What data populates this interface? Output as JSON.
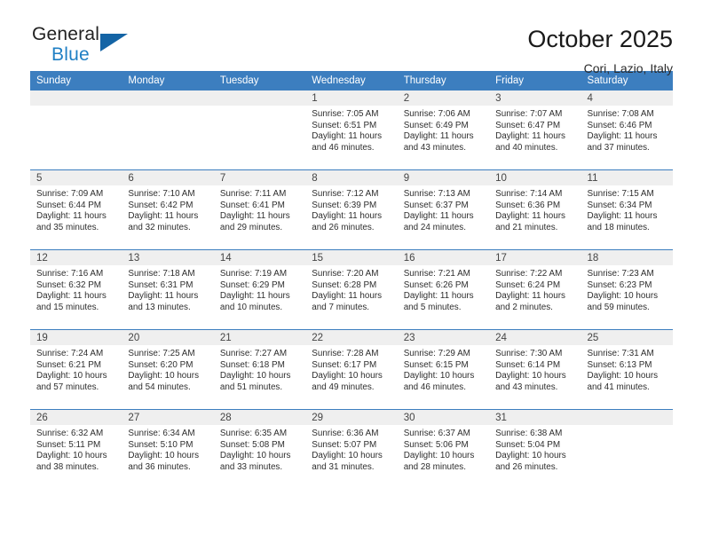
{
  "brand": {
    "name_top": "General",
    "name_bottom": "Blue",
    "accent_color": "#1f7fc4",
    "triangle_color": "#1464a5"
  },
  "header": {
    "title": "October 2025",
    "location": "Cori, Lazio, Italy"
  },
  "calendar": {
    "header_bg": "#3c7ebf",
    "daynum_bg": "#efefef",
    "weekday_names": [
      "Sunday",
      "Monday",
      "Tuesday",
      "Wednesday",
      "Thursday",
      "Friday",
      "Saturday"
    ],
    "weeks": [
      [
        {
          "day": "",
          "empty": true,
          "lines": []
        },
        {
          "day": "",
          "empty": true,
          "lines": []
        },
        {
          "day": "",
          "empty": true,
          "lines": []
        },
        {
          "day": "1",
          "lines": [
            "Sunrise: 7:05 AM",
            "Sunset: 6:51 PM",
            "Daylight: 11 hours",
            "and 46 minutes."
          ]
        },
        {
          "day": "2",
          "lines": [
            "Sunrise: 7:06 AM",
            "Sunset: 6:49 PM",
            "Daylight: 11 hours",
            "and 43 minutes."
          ]
        },
        {
          "day": "3",
          "lines": [
            "Sunrise: 7:07 AM",
            "Sunset: 6:47 PM",
            "Daylight: 11 hours",
            "and 40 minutes."
          ]
        },
        {
          "day": "4",
          "lines": [
            "Sunrise: 7:08 AM",
            "Sunset: 6:46 PM",
            "Daylight: 11 hours",
            "and 37 minutes."
          ]
        }
      ],
      [
        {
          "day": "5",
          "lines": [
            "Sunrise: 7:09 AM",
            "Sunset: 6:44 PM",
            "Daylight: 11 hours",
            "and 35 minutes."
          ]
        },
        {
          "day": "6",
          "lines": [
            "Sunrise: 7:10 AM",
            "Sunset: 6:42 PM",
            "Daylight: 11 hours",
            "and 32 minutes."
          ]
        },
        {
          "day": "7",
          "lines": [
            "Sunrise: 7:11 AM",
            "Sunset: 6:41 PM",
            "Daylight: 11 hours",
            "and 29 minutes."
          ]
        },
        {
          "day": "8",
          "lines": [
            "Sunrise: 7:12 AM",
            "Sunset: 6:39 PM",
            "Daylight: 11 hours",
            "and 26 minutes."
          ]
        },
        {
          "day": "9",
          "lines": [
            "Sunrise: 7:13 AM",
            "Sunset: 6:37 PM",
            "Daylight: 11 hours",
            "and 24 minutes."
          ]
        },
        {
          "day": "10",
          "lines": [
            "Sunrise: 7:14 AM",
            "Sunset: 6:36 PM",
            "Daylight: 11 hours",
            "and 21 minutes."
          ]
        },
        {
          "day": "11",
          "lines": [
            "Sunrise: 7:15 AM",
            "Sunset: 6:34 PM",
            "Daylight: 11 hours",
            "and 18 minutes."
          ]
        }
      ],
      [
        {
          "day": "12",
          "lines": [
            "Sunrise: 7:16 AM",
            "Sunset: 6:32 PM",
            "Daylight: 11 hours",
            "and 15 minutes."
          ]
        },
        {
          "day": "13",
          "lines": [
            "Sunrise: 7:18 AM",
            "Sunset: 6:31 PM",
            "Daylight: 11 hours",
            "and 13 minutes."
          ]
        },
        {
          "day": "14",
          "lines": [
            "Sunrise: 7:19 AM",
            "Sunset: 6:29 PM",
            "Daylight: 11 hours",
            "and 10 minutes."
          ]
        },
        {
          "day": "15",
          "lines": [
            "Sunrise: 7:20 AM",
            "Sunset: 6:28 PM",
            "Daylight: 11 hours",
            "and 7 minutes."
          ]
        },
        {
          "day": "16",
          "lines": [
            "Sunrise: 7:21 AM",
            "Sunset: 6:26 PM",
            "Daylight: 11 hours",
            "and 5 minutes."
          ]
        },
        {
          "day": "17",
          "lines": [
            "Sunrise: 7:22 AM",
            "Sunset: 6:24 PM",
            "Daylight: 11 hours",
            "and 2 minutes."
          ]
        },
        {
          "day": "18",
          "lines": [
            "Sunrise: 7:23 AM",
            "Sunset: 6:23 PM",
            "Daylight: 10 hours",
            "and 59 minutes."
          ]
        }
      ],
      [
        {
          "day": "19",
          "lines": [
            "Sunrise: 7:24 AM",
            "Sunset: 6:21 PM",
            "Daylight: 10 hours",
            "and 57 minutes."
          ]
        },
        {
          "day": "20",
          "lines": [
            "Sunrise: 7:25 AM",
            "Sunset: 6:20 PM",
            "Daylight: 10 hours",
            "and 54 minutes."
          ]
        },
        {
          "day": "21",
          "lines": [
            "Sunrise: 7:27 AM",
            "Sunset: 6:18 PM",
            "Daylight: 10 hours",
            "and 51 minutes."
          ]
        },
        {
          "day": "22",
          "lines": [
            "Sunrise: 7:28 AM",
            "Sunset: 6:17 PM",
            "Daylight: 10 hours",
            "and 49 minutes."
          ]
        },
        {
          "day": "23",
          "lines": [
            "Sunrise: 7:29 AM",
            "Sunset: 6:15 PM",
            "Daylight: 10 hours",
            "and 46 minutes."
          ]
        },
        {
          "day": "24",
          "lines": [
            "Sunrise: 7:30 AM",
            "Sunset: 6:14 PM",
            "Daylight: 10 hours",
            "and 43 minutes."
          ]
        },
        {
          "day": "25",
          "lines": [
            "Sunrise: 7:31 AM",
            "Sunset: 6:13 PM",
            "Daylight: 10 hours",
            "and 41 minutes."
          ]
        }
      ],
      [
        {
          "day": "26",
          "lines": [
            "Sunrise: 6:32 AM",
            "Sunset: 5:11 PM",
            "Daylight: 10 hours",
            "and 38 minutes."
          ]
        },
        {
          "day": "27",
          "lines": [
            "Sunrise: 6:34 AM",
            "Sunset: 5:10 PM",
            "Daylight: 10 hours",
            "and 36 minutes."
          ]
        },
        {
          "day": "28",
          "lines": [
            "Sunrise: 6:35 AM",
            "Sunset: 5:08 PM",
            "Daylight: 10 hours",
            "and 33 minutes."
          ]
        },
        {
          "day": "29",
          "lines": [
            "Sunrise: 6:36 AM",
            "Sunset: 5:07 PM",
            "Daylight: 10 hours",
            "and 31 minutes."
          ]
        },
        {
          "day": "30",
          "lines": [
            "Sunrise: 6:37 AM",
            "Sunset: 5:06 PM",
            "Daylight: 10 hours",
            "and 28 minutes."
          ]
        },
        {
          "day": "31",
          "lines": [
            "Sunrise: 6:38 AM",
            "Sunset: 5:04 PM",
            "Daylight: 10 hours",
            "and 26 minutes."
          ]
        },
        {
          "day": "",
          "empty": true,
          "lines": []
        }
      ]
    ]
  }
}
